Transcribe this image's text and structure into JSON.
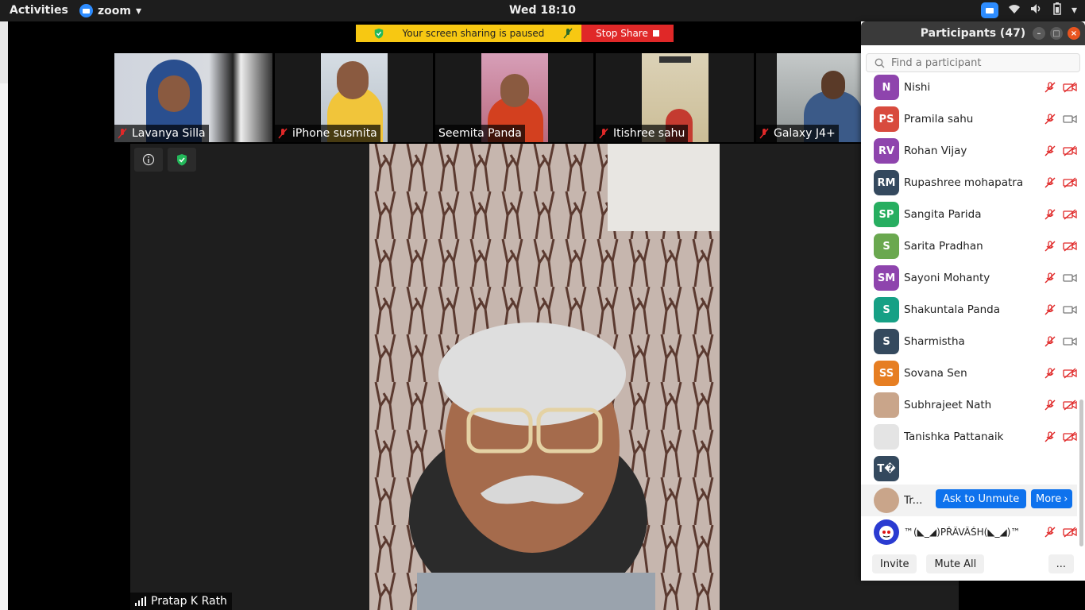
{
  "topbar": {
    "activities": "Activities",
    "app_name": "zoom",
    "clock": "Wed 18:10"
  },
  "share_bar": {
    "paused_text": "Your screen sharing is paused",
    "stop_label": "Stop Share"
  },
  "gallery": [
    {
      "name": "Lavanya Silla",
      "muted": true
    },
    {
      "name": "iPhone susmita",
      "muted": true
    },
    {
      "name": "Seemita Panda",
      "muted": false
    },
    {
      "name": "Itishree sahu",
      "muted": true
    },
    {
      "name": "Galaxy J4+",
      "muted": true
    }
  ],
  "active_speaker": {
    "name": "Pratap K Rath"
  },
  "participants": {
    "title": "Participants (47)",
    "search_placeholder": "Find a participant",
    "rows": [
      {
        "initials": "N",
        "name": "Nishi",
        "color": "#8e44ad",
        "video_off": true
      },
      {
        "initials": "PS",
        "name": "Pramila sahu",
        "color": "#d84b3e",
        "video_off": false
      },
      {
        "initials": "RV",
        "name": "Rohan Vijay",
        "color": "#8e44ad",
        "video_off": true
      },
      {
        "initials": "RM",
        "name": "Rupashree  mohapatra",
        "color": "#34495e",
        "video_off": true
      },
      {
        "initials": "SP",
        "name": "Sangita Parida",
        "color": "#27ae60",
        "video_off": true
      },
      {
        "initials": "S",
        "name": "Sarita Pradhan",
        "color": "#6aa84f",
        "video_off": true
      },
      {
        "initials": "SM",
        "name": "Sayoni Mohanty",
        "color": "#8e44ad",
        "video_off": false
      },
      {
        "initials": "S",
        "name": "Shakuntala Panda",
        "color": "#16a085",
        "video_off": false
      },
      {
        "initials": "S",
        "name": "Sharmistha",
        "color": "#34495e",
        "video_off": false
      },
      {
        "initials": "SS",
        "name": "Sovana Sen",
        "color": "#e67e22",
        "video_off": true
      },
      {
        "initials": "",
        "name": "Subhrajeet Nath",
        "color": "#c9a58a",
        "video_off": true
      },
      {
        "initials": "",
        "name": "Tanishka Pattanaik",
        "color": "#e4e4e4",
        "video_off": true
      },
      {
        "initials": "T�",
        "name": "",
        "color": "#34495e",
        "video_off": false
      }
    ],
    "hover_row": {
      "name": "Tr...",
      "unmute_label": "Ask to Unmute",
      "more_label": "More"
    },
    "last_row": {
      "name": "™(◣_◢)PŘÃVÂŠH(◣_◢)™"
    },
    "footer": {
      "invite": "Invite",
      "mute_all": "Mute All",
      "more": "..."
    }
  }
}
